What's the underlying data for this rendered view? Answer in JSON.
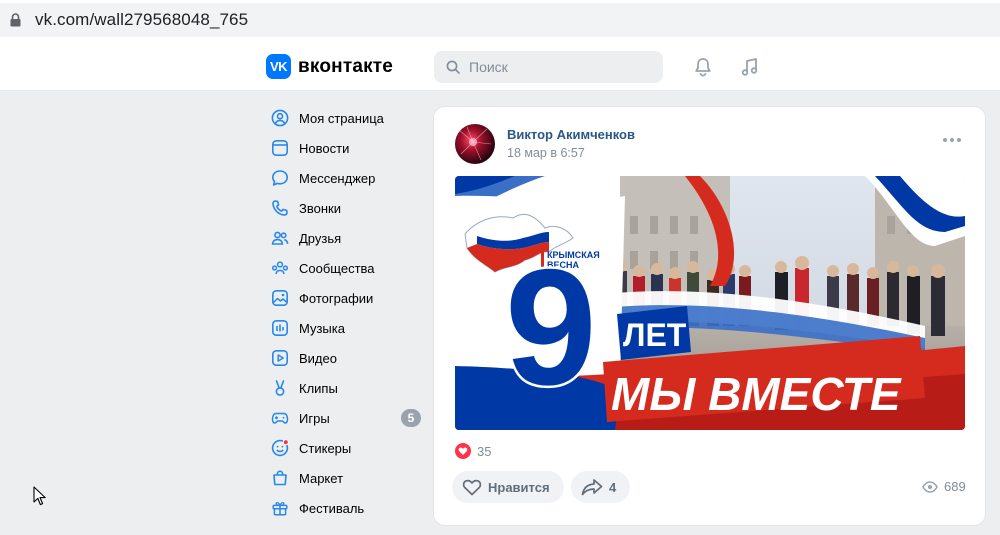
{
  "browser": {
    "url": "vk.com/wall279568048_765"
  },
  "header": {
    "logo_text": "вконтакте",
    "logo_mark": "VK",
    "search": {
      "placeholder": "Поиск"
    },
    "icons": [
      "bell-icon",
      "music-icon"
    ]
  },
  "nav": {
    "items": [
      {
        "label": "Моя страница",
        "icon": "user-circle-icon"
      },
      {
        "label": "Новости",
        "icon": "news-icon"
      },
      {
        "label": "Мессенджер",
        "icon": "message-icon"
      },
      {
        "label": "Звонки",
        "icon": "phone-icon"
      },
      {
        "label": "Друзья",
        "icon": "friends-icon"
      },
      {
        "label": "Сообщества",
        "icon": "communities-icon"
      },
      {
        "label": "Фотографии",
        "icon": "photo-icon"
      },
      {
        "label": "Музыка",
        "icon": "music-icon"
      },
      {
        "label": "Видео",
        "icon": "video-icon"
      },
      {
        "label": "Клипы",
        "icon": "clips-icon"
      },
      {
        "label": "Игры",
        "icon": "gamepad-icon",
        "badge": "5"
      },
      {
        "label": "Стикеры",
        "icon": "stickers-icon"
      },
      {
        "label": "Маркет",
        "icon": "market-icon"
      },
      {
        "label": "Фестиваль",
        "icon": "gift-icon"
      }
    ]
  },
  "post": {
    "author": "Виктор Акимченков",
    "date": "18 мар в 6:57",
    "image": {
      "region_label_line1": "КРЫМСКАЯ",
      "region_label_line2": "ВЕСНА",
      "big_number": "9",
      "line1": "ЛЕТ",
      "line2": "МЫ ВМЕСТЕ"
    },
    "likes_count": "35",
    "like_label": "Нравится",
    "share_count": "4",
    "views_count": "689"
  },
  "colors": {
    "vk_blue": "#0077ff",
    "link_blue": "#2a5885",
    "like_red": "#ff3347",
    "russia_red": "#d52b1e",
    "russia_blue": "#0039a6"
  }
}
